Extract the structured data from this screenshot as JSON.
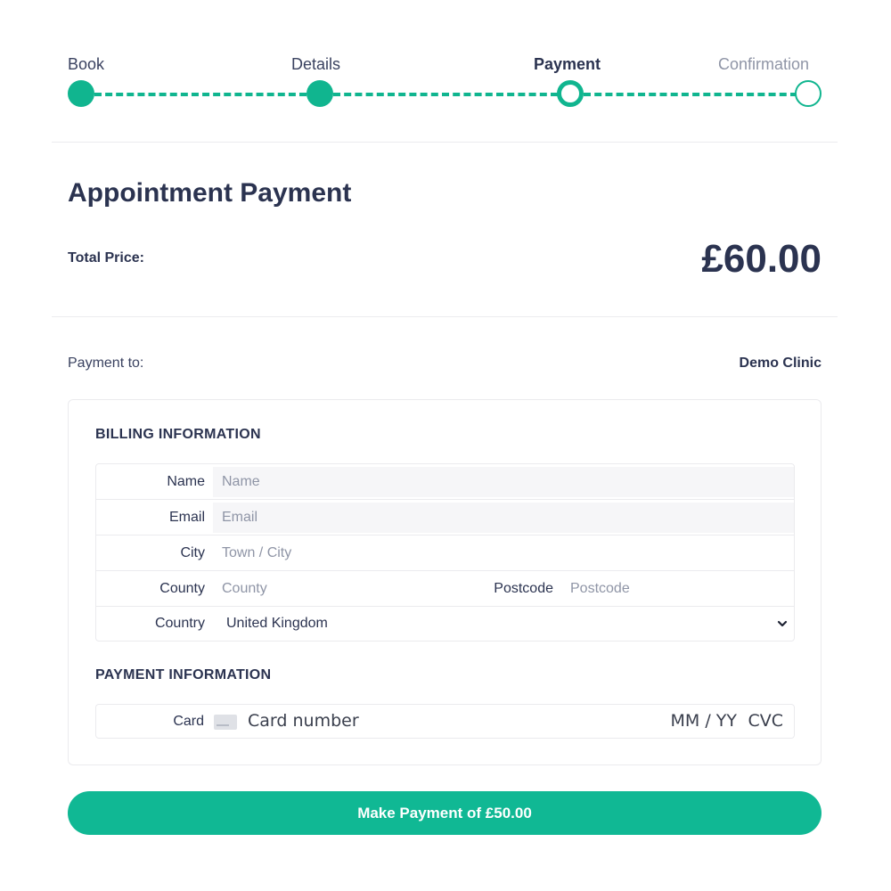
{
  "stepper": {
    "steps": [
      {
        "label": "Book",
        "state": "done"
      },
      {
        "label": "Details",
        "state": "done"
      },
      {
        "label": "Payment",
        "state": "current"
      },
      {
        "label": "Confirmation",
        "state": "todo"
      }
    ],
    "accent_color": "#10b58f"
  },
  "header": {
    "title": "Appointment Payment",
    "total_label": "Total Price:",
    "total_value": "£60.00"
  },
  "payee": {
    "label": "Payment to:",
    "value": "Demo Clinic"
  },
  "billing": {
    "section_title": "BILLING INFORMATION",
    "name": {
      "label": "Name",
      "placeholder": "Name",
      "value": ""
    },
    "email": {
      "label": "Email",
      "placeholder": "Email",
      "value": ""
    },
    "city": {
      "label": "City",
      "placeholder": "Town / City",
      "value": ""
    },
    "county": {
      "label": "County",
      "placeholder": "County",
      "value": ""
    },
    "postcode": {
      "label": "Postcode",
      "placeholder": "Postcode",
      "value": ""
    },
    "country": {
      "label": "Country",
      "selected": "United Kingdom"
    }
  },
  "payment": {
    "section_title": "PAYMENT INFORMATION",
    "card_label": "Card",
    "card_icon": "credit-card-icon",
    "card_number_placeholder": "Card number",
    "expiry_placeholder": "MM / YY",
    "cvc_placeholder": "CVC"
  },
  "submit": {
    "label": "Make Payment of £50.00",
    "color": "#10b894"
  }
}
